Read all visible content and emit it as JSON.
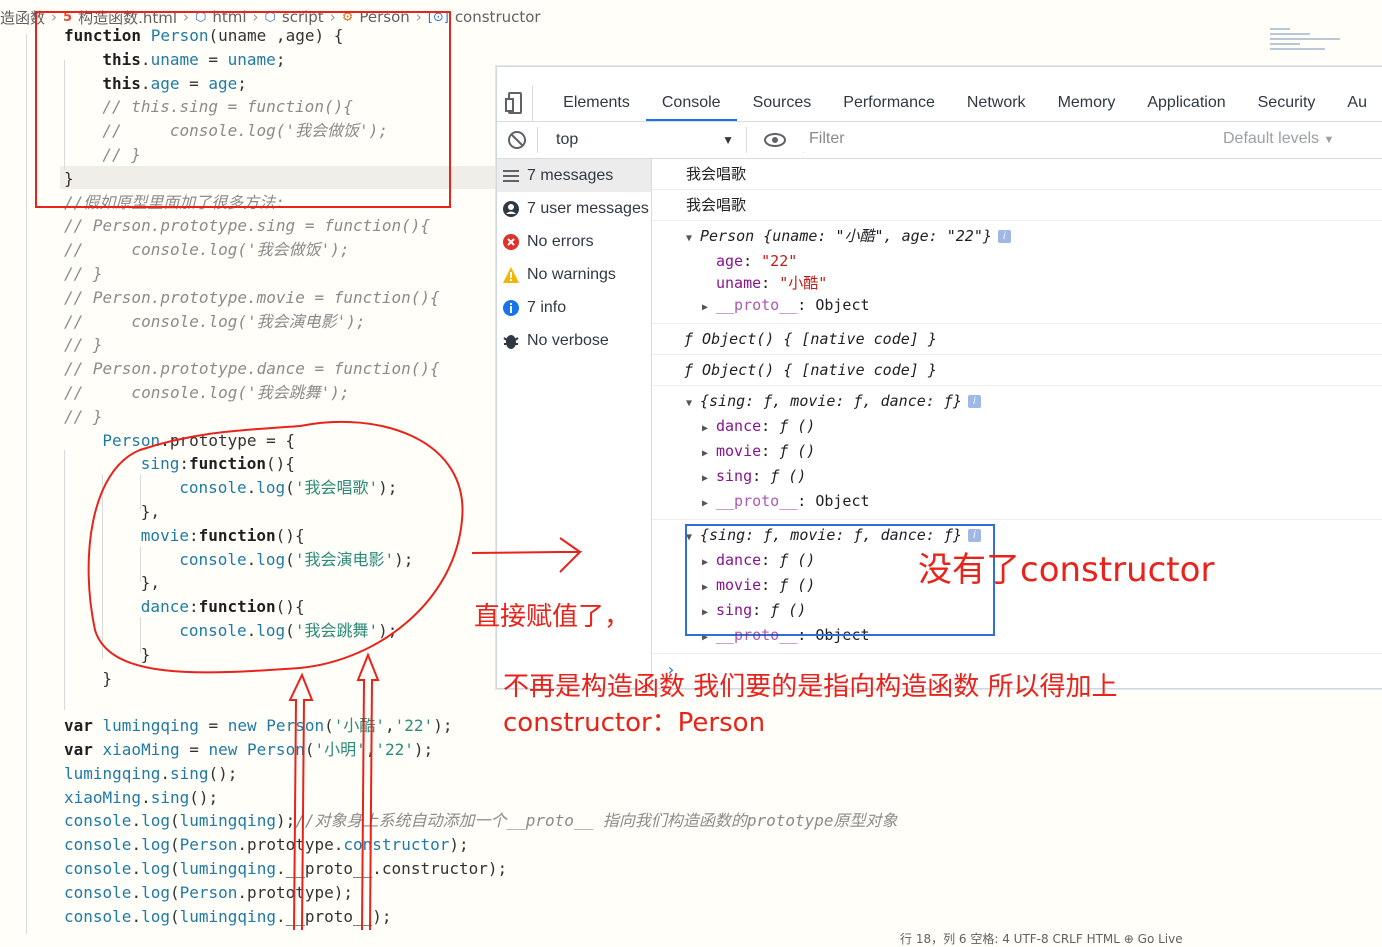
{
  "breadcrumb": {
    "items": [
      {
        "label": "造函数",
        "icon": ""
      },
      {
        "label": "构造函数.html",
        "icon": "html5-icon"
      },
      {
        "label": "html",
        "icon": "cube-icon"
      },
      {
        "label": "script",
        "icon": "cube-icon"
      },
      {
        "label": "Person",
        "icon": "class-icon"
      },
      {
        "label": "constructor",
        "icon": "field-icon"
      }
    ]
  },
  "code": {
    "lines": [
      {
        "top": 0,
        "indent": 0,
        "parts": [
          [
            "kw",
            "function "
          ],
          [
            "fn",
            "Person"
          ],
          [
            "pl",
            "(uname ,age) {"
          ]
        ]
      },
      {
        "indent": 2,
        "parts": [
          [
            "kw",
            "this"
          ],
          [
            "pl",
            "."
          ],
          [
            "vr",
            "uname"
          ],
          [
            "pl",
            " = "
          ],
          [
            "vr",
            "uname"
          ],
          [
            "pl",
            ";"
          ]
        ]
      },
      {
        "indent": 2,
        "parts": [
          [
            "kw",
            "this"
          ],
          [
            "pl",
            "."
          ],
          [
            "vr",
            "age"
          ],
          [
            "pl",
            " = "
          ],
          [
            "vr",
            "age"
          ],
          [
            "pl",
            ";"
          ]
        ]
      },
      {
        "indent": 2,
        "parts": [
          [
            "cm",
            "// this.sing = function(){"
          ]
        ]
      },
      {
        "indent": 2,
        "parts": [
          [
            "cm",
            "//     console.log('我会做饭');"
          ]
        ]
      },
      {
        "indent": 2,
        "parts": [
          [
            "cm",
            "// }"
          ]
        ]
      },
      {
        "indent": 0,
        "parts": [
          [
            "pl",
            "}"
          ]
        ]
      },
      {
        "indent": 0,
        "parts": [
          [
            "cm",
            "//假如原型里面加了很多方法:"
          ]
        ]
      },
      {
        "indent": 0,
        "parts": [
          [
            "cm",
            "// Person.prototype.sing = function(){"
          ]
        ]
      },
      {
        "indent": 0,
        "parts": [
          [
            "cm",
            "//     console.log('我会做饭');"
          ]
        ]
      },
      {
        "indent": 0,
        "parts": [
          [
            "cm",
            "// }"
          ]
        ]
      },
      {
        "indent": 0,
        "parts": [
          [
            "cm",
            "// Person.prototype.movie = function(){"
          ]
        ]
      },
      {
        "indent": 0,
        "parts": [
          [
            "cm",
            "//     console.log('我会演电影');"
          ]
        ]
      },
      {
        "indent": 0,
        "parts": [
          [
            "cm",
            "// }"
          ]
        ]
      },
      {
        "indent": 0,
        "parts": [
          [
            "cm",
            "// Person.prototype.dance = function(){"
          ]
        ]
      },
      {
        "indent": 0,
        "parts": [
          [
            "cm",
            "//     console.log('我会跳舞');"
          ]
        ]
      },
      {
        "indent": 0,
        "parts": [
          [
            "cm",
            "// }"
          ]
        ]
      },
      {
        "indent": 2,
        "parts": [
          [
            "fn",
            "Person"
          ],
          [
            "pl",
            ".prototype = {"
          ]
        ]
      },
      {
        "indent": 4,
        "parts": [
          [
            "vr",
            "sing"
          ],
          [
            "pl",
            ":"
          ],
          [
            "kw",
            "function"
          ],
          [
            "pl",
            "(){"
          ]
        ]
      },
      {
        "indent": 6,
        "parts": [
          [
            "vr",
            "console"
          ],
          [
            "pl",
            "."
          ],
          [
            "fn",
            "log"
          ],
          [
            "pl",
            "("
          ],
          [
            "str",
            "'我会唱歌'"
          ],
          [
            "pl",
            ");"
          ]
        ]
      },
      {
        "indent": 4,
        "parts": [
          [
            "pl",
            "},"
          ]
        ]
      },
      {
        "indent": 4,
        "parts": [
          [
            "vr",
            "movie"
          ],
          [
            "pl",
            ":"
          ],
          [
            "kw",
            "function"
          ],
          [
            "pl",
            "(){"
          ]
        ]
      },
      {
        "indent": 6,
        "parts": [
          [
            "vr",
            "console"
          ],
          [
            "pl",
            "."
          ],
          [
            "fn",
            "log"
          ],
          [
            "pl",
            "("
          ],
          [
            "str",
            "'我会演电影'"
          ],
          [
            "pl",
            ");"
          ]
        ]
      },
      {
        "indent": 4,
        "parts": [
          [
            "pl",
            "},"
          ]
        ]
      },
      {
        "indent": 4,
        "parts": [
          [
            "vr",
            "dance"
          ],
          [
            "pl",
            ":"
          ],
          [
            "kw",
            "function"
          ],
          [
            "pl",
            "(){"
          ]
        ]
      },
      {
        "indent": 6,
        "parts": [
          [
            "vr",
            "console"
          ],
          [
            "pl",
            "."
          ],
          [
            "fn",
            "log"
          ],
          [
            "pl",
            "("
          ],
          [
            "str",
            "'我会跳舞'"
          ],
          [
            "pl",
            ");"
          ]
        ]
      },
      {
        "indent": 4,
        "parts": [
          [
            "pl",
            "}"
          ]
        ]
      },
      {
        "indent": 2,
        "parts": [
          [
            "pl",
            "}"
          ]
        ]
      },
      {
        "indent": 0,
        "parts": [
          [
            "pl",
            ""
          ]
        ]
      },
      {
        "indent": 0,
        "parts": [
          [
            "kw",
            "var "
          ],
          [
            "vr",
            "lumingqing"
          ],
          [
            "pl",
            " = "
          ],
          [
            "fn",
            "new "
          ],
          [
            "fn",
            "Person"
          ],
          [
            "pl",
            "("
          ],
          [
            "str",
            "'小酷'"
          ],
          [
            "pl",
            ","
          ],
          [
            "str",
            "'22'"
          ],
          [
            "pl",
            ");"
          ]
        ]
      },
      {
        "indent": 0,
        "parts": [
          [
            "kw",
            "var "
          ],
          [
            "vr",
            "xiaoMing"
          ],
          [
            "pl",
            " = "
          ],
          [
            "fn",
            "new "
          ],
          [
            "fn",
            "Person"
          ],
          [
            "pl",
            "("
          ],
          [
            "str",
            "'小明'"
          ],
          [
            "pl",
            ","
          ],
          [
            "str",
            "'22'"
          ],
          [
            "pl",
            ");"
          ]
        ]
      },
      {
        "indent": 0,
        "parts": [
          [
            "vr",
            "lumingqing"
          ],
          [
            "pl",
            "."
          ],
          [
            "fn",
            "sing"
          ],
          [
            "pl",
            "();"
          ]
        ]
      },
      {
        "indent": 0,
        "parts": [
          [
            "vr",
            "xiaoMing"
          ],
          [
            "pl",
            "."
          ],
          [
            "fn",
            "sing"
          ],
          [
            "pl",
            "();"
          ]
        ]
      },
      {
        "indent": 0,
        "parts": [
          [
            "vr",
            "console"
          ],
          [
            "pl",
            "."
          ],
          [
            "fn",
            "log"
          ],
          [
            "pl",
            "("
          ],
          [
            "vr",
            "lumingqing"
          ],
          [
            "pl",
            ");"
          ],
          [
            "cm",
            "//对象身上系统自动添加一个__proto__ 指向我们构造函数的prototype原型对象"
          ]
        ]
      },
      {
        "indent": 0,
        "parts": [
          [
            "vr",
            "console"
          ],
          [
            "pl",
            "."
          ],
          [
            "fn",
            "log"
          ],
          [
            "pl",
            "("
          ],
          [
            "fn",
            "Person"
          ],
          [
            "pl",
            ".prototype."
          ],
          [
            "vr",
            "constructor"
          ],
          [
            "pl",
            ");"
          ]
        ]
      },
      {
        "indent": 0,
        "parts": [
          [
            "vr",
            "console"
          ],
          [
            "pl",
            "."
          ],
          [
            "fn",
            "log"
          ],
          [
            "pl",
            "("
          ],
          [
            "vr",
            "lumingqing"
          ],
          [
            "pl",
            ".__proto__.constructor);"
          ]
        ]
      },
      {
        "indent": 0,
        "parts": [
          [
            "vr",
            "console"
          ],
          [
            "pl",
            "."
          ],
          [
            "fn",
            "log"
          ],
          [
            "pl",
            "("
          ],
          [
            "fn",
            "Person"
          ],
          [
            "pl",
            ".prototype);"
          ]
        ]
      },
      {
        "indent": 0,
        "parts": [
          [
            "vr",
            "console"
          ],
          [
            "pl",
            "."
          ],
          [
            "fn",
            "log"
          ],
          [
            "pl",
            "("
          ],
          [
            "vr",
            "lumingqing"
          ],
          [
            "pl",
            ".__proto__);"
          ]
        ]
      }
    ]
  },
  "devtools": {
    "tabs": [
      "Elements",
      "Console",
      "Sources",
      "Performance",
      "Network",
      "Memory",
      "Application",
      "Security",
      "Au"
    ],
    "active_tab": "Console",
    "context": "top",
    "filter_placeholder": "Filter",
    "levels": "Default levels",
    "sidebar": [
      {
        "label": "7 messages",
        "icon": "list-icon"
      },
      {
        "label": "7 user messages",
        "icon": "user-icon"
      },
      {
        "label": "No errors",
        "icon": "error-icon"
      },
      {
        "label": "No warnings",
        "icon": "warning-icon"
      },
      {
        "label": "7 info",
        "icon": "info-icon"
      },
      {
        "label": "No verbose",
        "icon": "bug-icon"
      }
    ],
    "messages": {
      "m1": "我会唱歌",
      "m2": "我会唱歌",
      "obj_head": "Person {uname: \"小酷\", age: \"22\"}",
      "age_key": "age",
      "age_val": "\"22\"",
      "uname_key": "uname",
      "uname_val": "\"小酷\"",
      "proto_key": "__proto__",
      "proto_val": "Object",
      "fn1": "ƒ Object() { [native code] }",
      "fn2": "ƒ Object() { [native code] }",
      "proto_head": "{sing: ƒ, movie: ƒ, dance: ƒ}",
      "dance": "dance",
      "movie": "movie",
      "sing": "sing",
      "fval": "ƒ ()",
      "proto2_head": "{sing: ƒ, movie: ƒ, dance: ƒ}"
    }
  },
  "annotations": {
    "no_constructor": "没有了constructor",
    "direct_assign": "直接赋值了，",
    "explain_line1": "不再是构造函数 我们要的是指向构造函数 所以得加上",
    "explain_line2": "constructor：Person"
  },
  "statusbar": "行 18，列 6   空格: 4   UTF-8   CRLF   HTML   ⊕ Go Live",
  "colors": {
    "accent": "#1a73e8",
    "annotation": "#e8231b"
  }
}
